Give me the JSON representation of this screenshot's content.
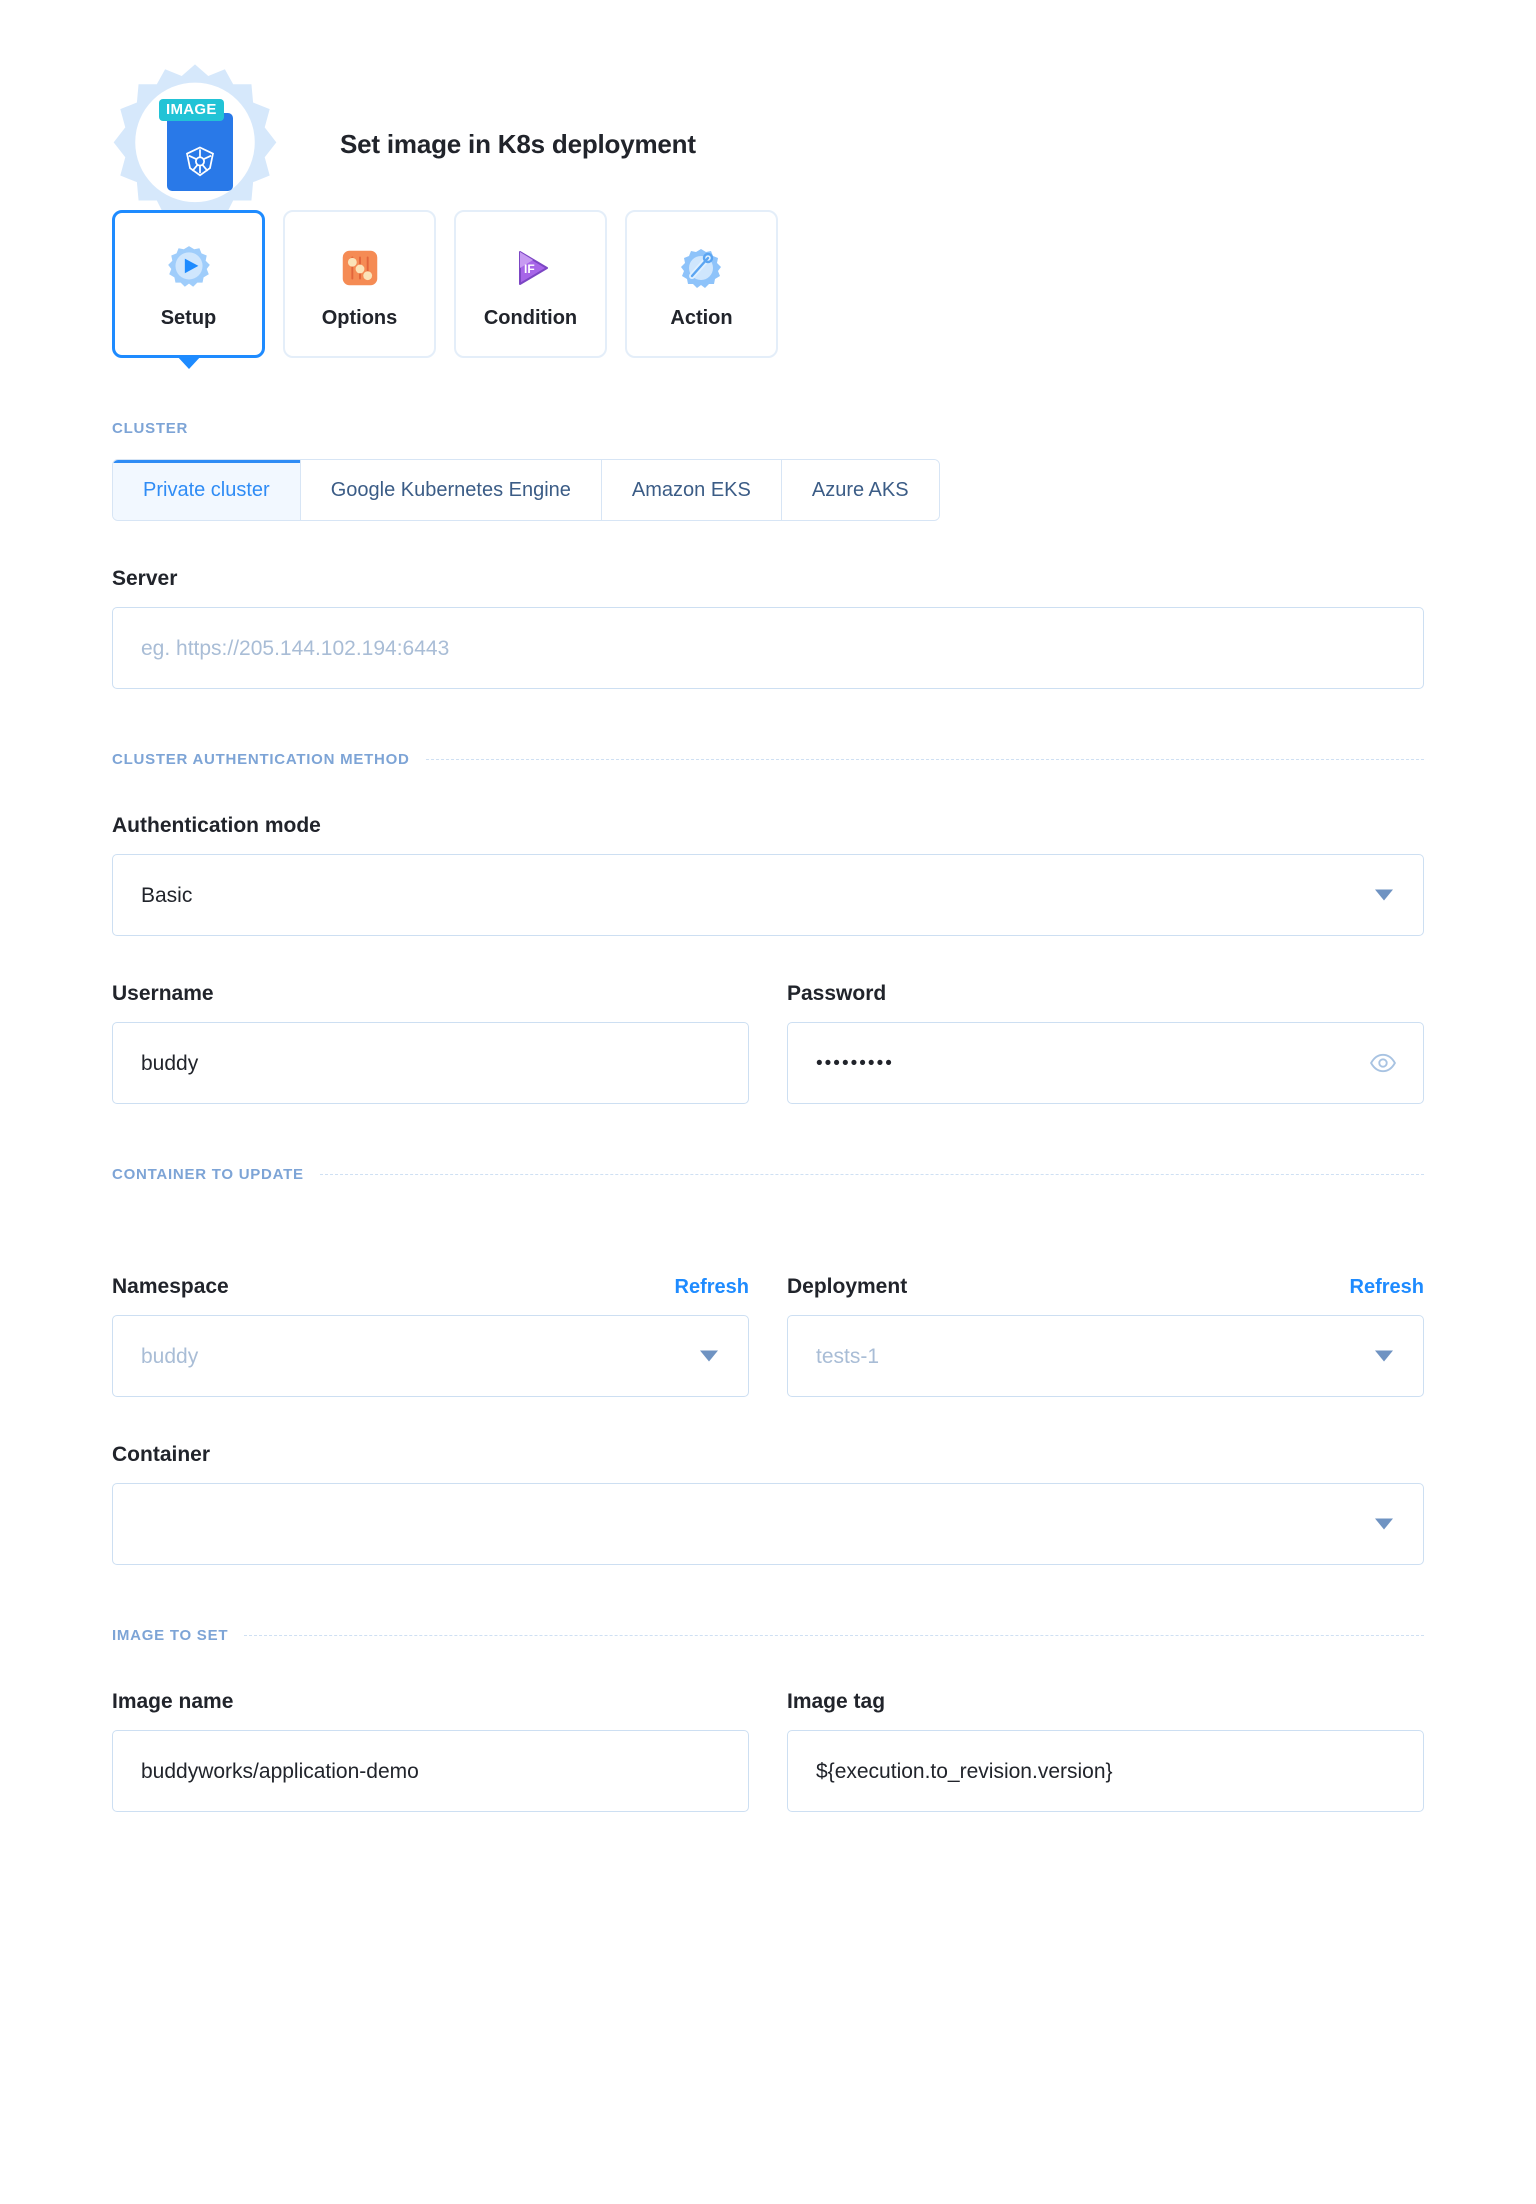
{
  "header": {
    "title": "Set image in K8s deployment",
    "badge_chip": "IMAGE",
    "icon": "kubernetes-image-icon"
  },
  "tabs": [
    {
      "label": "Setup",
      "icon": "setup-gear-play-icon",
      "active": true
    },
    {
      "label": "Options",
      "icon": "options-sliders-icon",
      "active": false
    },
    {
      "label": "Condition",
      "icon": "condition-if-play-icon",
      "active": false
    },
    {
      "label": "Action",
      "icon": "action-gear-wand-icon",
      "active": false
    }
  ],
  "cluster": {
    "section_title": "CLUSTER",
    "options": [
      {
        "label": "Private cluster",
        "active": true
      },
      {
        "label": "Google Kubernetes Engine",
        "active": false
      },
      {
        "label": "Amazon EKS",
        "active": false
      },
      {
        "label": "Azure AKS",
        "active": false
      }
    ],
    "server": {
      "label": "Server",
      "value": "",
      "placeholder": "eg. https://205.144.102.194:6443"
    }
  },
  "auth": {
    "section_title": "CLUSTER AUTHENTICATION METHOD",
    "mode": {
      "label": "Authentication mode",
      "value": "Basic",
      "options": [
        "Basic"
      ]
    },
    "username": {
      "label": "Username",
      "value": "buddy",
      "placeholder": ""
    },
    "password": {
      "label": "Password",
      "value": "•••••••••",
      "placeholder": "",
      "toggle_icon": "eye-icon"
    }
  },
  "container_to_update": {
    "section_title": "CONTAINER TO UPDATE",
    "namespace": {
      "label": "Namespace",
      "refresh_label": "Refresh",
      "value": "",
      "placeholder": "buddy"
    },
    "deployment": {
      "label": "Deployment",
      "refresh_label": "Refresh",
      "value": "",
      "placeholder": "tests-1"
    },
    "container": {
      "label": "Container",
      "value": "",
      "placeholder": ""
    }
  },
  "image_to_set": {
    "section_title": "IMAGE TO SET",
    "image_name": {
      "label": "Image name",
      "value": "buddyworks/application-demo",
      "placeholder": ""
    },
    "image_tag": {
      "label": "Image tag",
      "value": "${execution.to_revision.version}",
      "placeholder": ""
    }
  },
  "colors": {
    "accent_blue": "#1e8bff",
    "section_label": "#7da4d6",
    "border": "#cddff2",
    "placeholder": "#a9bdd6",
    "text": "#21242b",
    "chip_teal": "#22c3d6",
    "k8s_blue": "#2979e8"
  }
}
